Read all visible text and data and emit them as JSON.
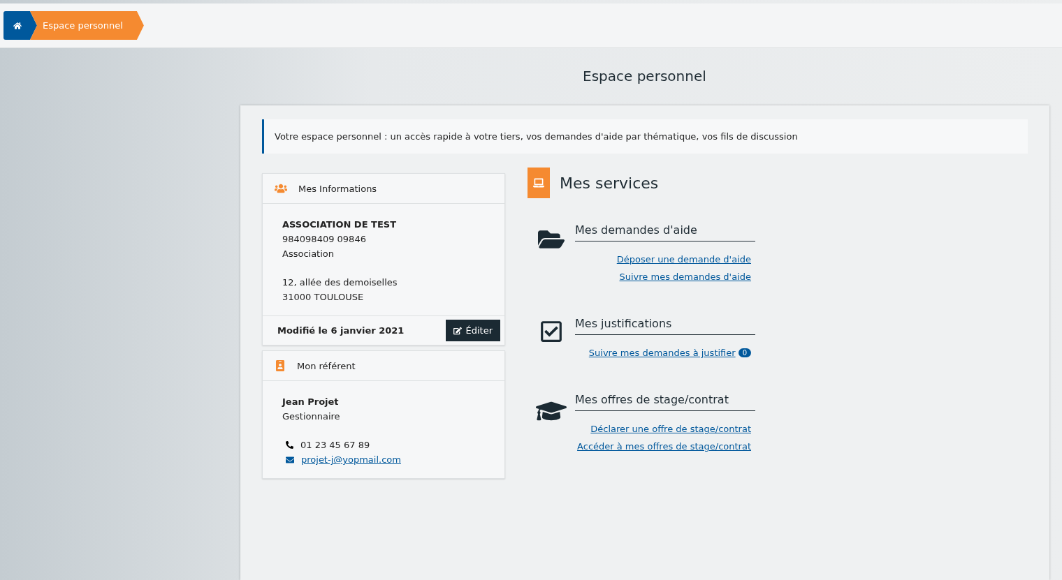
{
  "breadcrumb": {
    "items": [
      {
        "kind": "home"
      },
      {
        "kind": "page",
        "label": "Espace personnel"
      }
    ]
  },
  "page_title": "Espace personnel",
  "intro": "Votre espace personnel : un accès rapide à votre tiers, vos demandes d'aide par thématique, vos fils de discussion",
  "info_card": {
    "title": "Mes Informations",
    "name": "ASSOCIATION DE TEST",
    "lines": [
      "984098409 09846",
      "Association"
    ],
    "address": [
      "12, allée des demoiselles",
      "31000 TOULOUSE"
    ],
    "modified": "Modifié le 6 janvier 2021",
    "edit_button": "Éditer"
  },
  "referent_card": {
    "title": "Mon référent",
    "name": "Jean Projet",
    "role": "Gestionnaire",
    "phone": "01 23 45 67 89",
    "email": "projet-j@yopmail.com"
  },
  "services": {
    "title": "Mes services",
    "sections": [
      {
        "kind": "folder",
        "title": "Mes demandes d'aide",
        "links": [
          {
            "label": "Déposer une demande d'aide"
          },
          {
            "label": "Suivre mes demandes d'aide"
          }
        ]
      },
      {
        "kind": "check",
        "title": "Mes justifications",
        "links": [
          {
            "label": "Suivre mes demandes à justifier",
            "badge": "0"
          }
        ]
      },
      {
        "kind": "cap",
        "title": "Mes offres de stage/contrat",
        "links": [
          {
            "label": "Déclarer une offre de stage/contrat"
          },
          {
            "label": "Accéder à mes offres de stage/contrat"
          }
        ]
      }
    ]
  }
}
